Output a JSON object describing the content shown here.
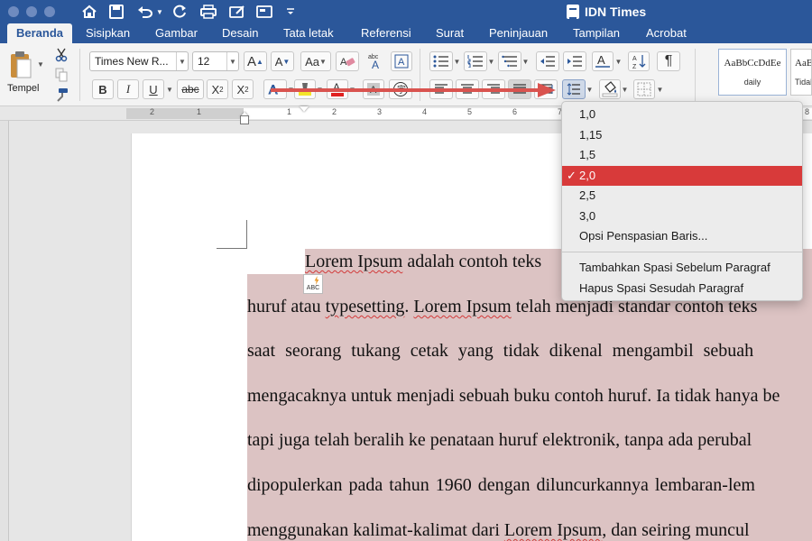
{
  "window": {
    "title": "IDN Times"
  },
  "tabs": [
    "Beranda",
    "Sisipkan",
    "Gambar",
    "Desain",
    "Tata letak",
    "Referensi",
    "Surat",
    "Peninjauan",
    "Tampilan",
    "Acrobat"
  ],
  "ribbon": {
    "paste_label": "Tempel",
    "font_name": "Times New R...",
    "font_size": "12",
    "grow_label": "A",
    "shrink_label": "A",
    "case_label": "Aa",
    "bold": "B",
    "italic": "I",
    "underline": "U",
    "strike": "abc",
    "subscript": "X",
    "superscript": "X",
    "sub_mark": "2",
    "sup_mark": "2",
    "pilcrow": "¶",
    "styles": [
      {
        "sample": "AaBbCcDdEe",
        "name": "daily"
      },
      {
        "sample": "AaBbC",
        "name": "Tidak"
      }
    ]
  },
  "line_spacing_menu": {
    "items": [
      "1,0",
      "1,15",
      "1,5",
      "2,0",
      "2,5",
      "3,0",
      "Opsi Penspasian Baris..."
    ],
    "selected": "2,0",
    "check": "✓",
    "extra": [
      "Tambahkan Spasi Sebelum Paragraf",
      "Hapus Spasi Sesudah Paragraf"
    ]
  },
  "ruler": {
    "numbers": [
      "2",
      "1",
      "1",
      "2",
      "3",
      "4",
      "5",
      "6",
      "7",
      "8"
    ]
  },
  "document": {
    "lines": [
      [
        "Lorem Ipsum",
        " adalah contoh teks"
      ],
      [
        "huruf atau ",
        "typesetting",
        ". ",
        "Lorem Ipsum",
        " telah menjadi standar contoh teks"
      ],
      [
        "saat seorang tukang cetak yang tidak dikenal mengambil sebuah"
      ],
      [
        "mengacaknya untuk menjadi sebuah buku contoh huruf. Ia tidak hanya be"
      ],
      [
        "tapi juga telah beralih ke penataan huruf elektronik, tanpa ada perubal"
      ],
      [
        "dipopulerkan pada tahun 1960 dengan diluncurkannya lembaran-lem"
      ],
      [
        "menggunakan kalimat-kalimat dari ",
        "Lorem Ipsum",
        ", dan seiring muncul"
      ]
    ],
    "abc_label": "ABC"
  },
  "colors": {
    "brand": "#2b579a",
    "highlight": "#dcc3c3",
    "menu_selected": "#d83a3a",
    "annotation_arrow": "#d9534f"
  }
}
